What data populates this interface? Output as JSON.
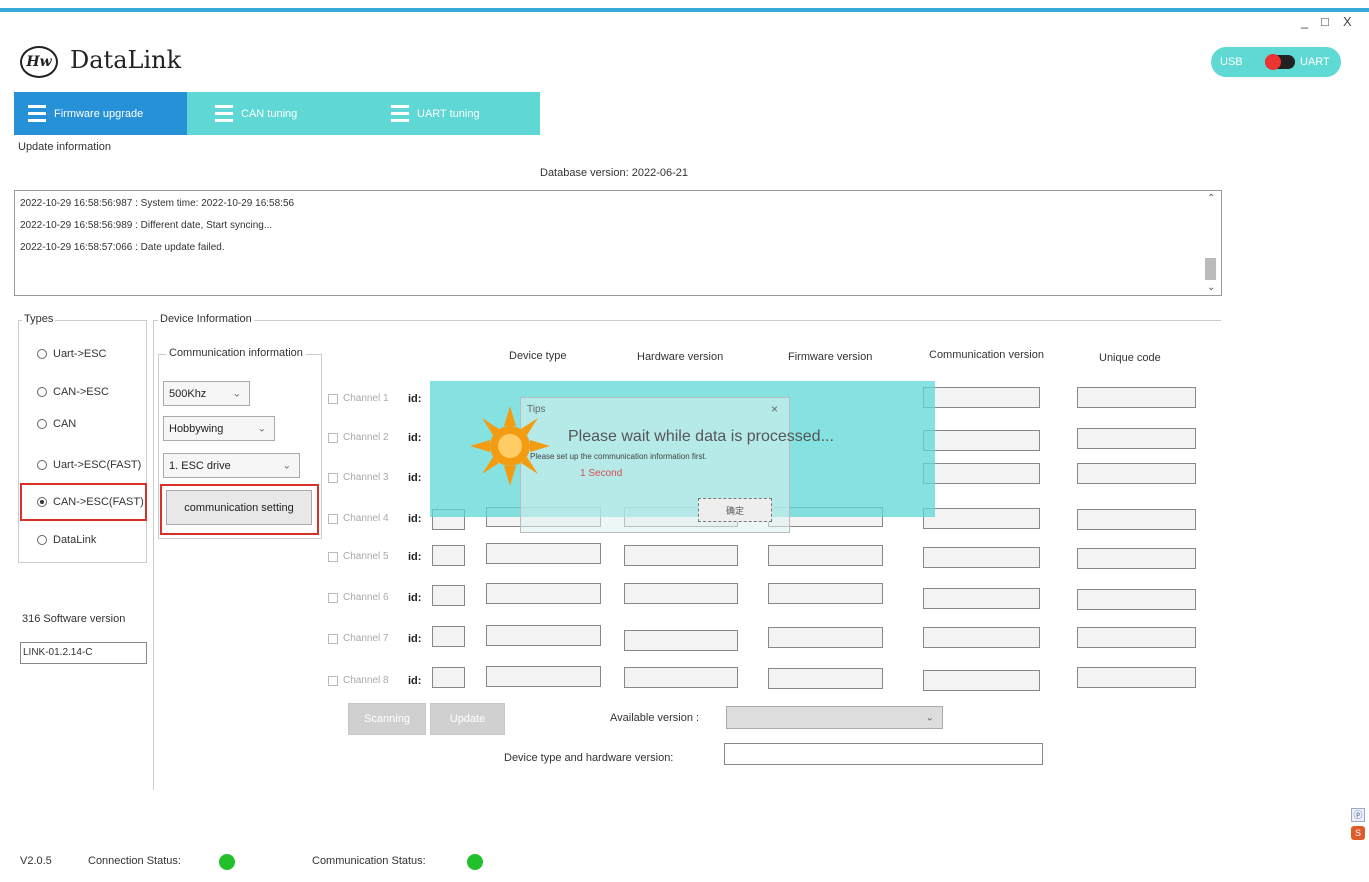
{
  "window": {
    "controls": [
      "_",
      "□",
      "X"
    ]
  },
  "app": {
    "logo_text": "Hw",
    "title": "DataLink"
  },
  "mode_toggle": {
    "left": "USB",
    "right": "UART"
  },
  "tabs": [
    {
      "label": "Firmware upgrade"
    },
    {
      "label": "CAN tuning"
    },
    {
      "label": "UART tuning"
    }
  ],
  "update_info": {
    "label": "Update information",
    "database_version": "Database version: 2022-06-21",
    "log": [
      "2022-10-29 16:58:56:987 : System time: 2022-10-29 16:58:56",
      "2022-10-29 16:58:56:989 : Different date, Start syncing...",
      "2022-10-29 16:58:57:066 : Date update failed."
    ]
  },
  "types": {
    "label": "Types",
    "options": [
      {
        "label": "Uart->ESC",
        "selected": false
      },
      {
        "label": "CAN->ESC",
        "selected": false
      },
      {
        "label": "CAN",
        "selected": false
      },
      {
        "label": "Uart->ESC(FAST)",
        "selected": false
      },
      {
        "label": "CAN->ESC(FAST)",
        "selected": true
      },
      {
        "label": "DataLink",
        "selected": false
      }
    ]
  },
  "software": {
    "label": "316 Software version",
    "value": "LINK-01.2.14-C"
  },
  "device_info": {
    "label": "Device Information",
    "comm_label": "Communication information",
    "baud": "500Khz",
    "protocol": "Hobbywing",
    "drive": "1. ESC drive",
    "comm_setting_button": "communication setting",
    "columns": [
      "Device type",
      "Hardware version",
      "Firmware version",
      "Communication version",
      "Unique code"
    ],
    "channels": [
      "Channel 1",
      "Channel 2",
      "Channel 3",
      "Channel 4",
      "Channel 5",
      "Channel 6",
      "Channel 7",
      "Channel 8"
    ],
    "id_label": "id:",
    "scanning_button": "Scanning",
    "update_button": "Update",
    "available_version_label": "Available version :",
    "device_hw_label": "Device type and hardware version:"
  },
  "dialog": {
    "title": "Tips",
    "close": "×",
    "wait_message": "Please wait while data is processed...",
    "message": "Please set up the communication information first.",
    "seconds": "1 Second",
    "ok_button": "确定"
  },
  "status_bar": {
    "version": "V2.0.5",
    "connection_label": "Connection Status:",
    "communication_label": "Communication Status:"
  },
  "colors": {
    "accent": "#5fd8d5",
    "active_tab": "#2791d8",
    "highlight": "#d9302a",
    "status_ok": "#22c02a"
  }
}
